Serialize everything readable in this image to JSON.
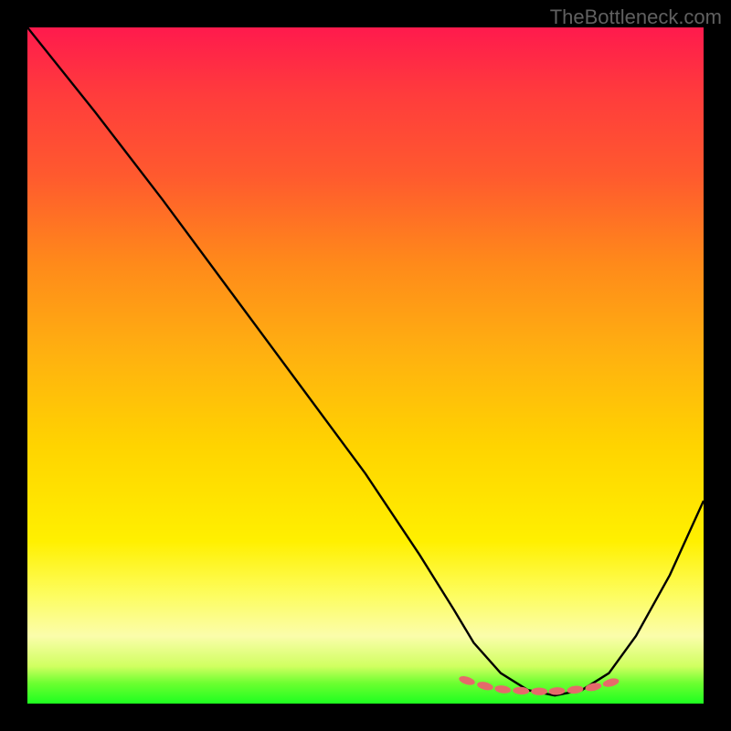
{
  "watermark": "TheBottleneck.com",
  "chart_data": {
    "type": "line",
    "title": "",
    "xlabel": "",
    "ylabel": "",
    "xlim": [
      0,
      100
    ],
    "ylim": [
      0,
      100
    ],
    "series": [
      {
        "name": "bottleneck-curve",
        "x": [
          0,
          10,
          20,
          30,
          40,
          50,
          58,
          63,
          66,
          70,
          74,
          78,
          82,
          86,
          90,
          95,
          100
        ],
        "values": [
          100,
          87.5,
          74.5,
          61,
          47.5,
          34,
          22,
          14,
          9,
          4.5,
          2,
          1.2,
          2,
          4.5,
          10,
          19,
          30
        ]
      }
    ],
    "markers": {
      "name": "dotted-basin",
      "color": "#e56a6a",
      "x": [
        65,
        67.7,
        70.3,
        73,
        75.7,
        78.3,
        81,
        83.7,
        86.3
      ],
      "values": [
        3.4,
        2.6,
        2.1,
        1.9,
        1.8,
        1.85,
        2.05,
        2.45,
        3.1
      ]
    },
    "gradient_stops": [
      {
        "pos": 0,
        "color": "#ff1a4d"
      },
      {
        "pos": 0.1,
        "color": "#ff3c3c"
      },
      {
        "pos": 0.22,
        "color": "#ff5a2e"
      },
      {
        "pos": 0.35,
        "color": "#ff8a1a"
      },
      {
        "pos": 0.48,
        "color": "#ffb010"
      },
      {
        "pos": 0.62,
        "color": "#ffd400"
      },
      {
        "pos": 0.76,
        "color": "#fff000"
      },
      {
        "pos": 0.84,
        "color": "#fdfd60"
      },
      {
        "pos": 0.9,
        "color": "#fbfdab"
      },
      {
        "pos": 0.945,
        "color": "#d0ff60"
      },
      {
        "pos": 0.97,
        "color": "#6cff30"
      },
      {
        "pos": 1.0,
        "color": "#1eff20"
      }
    ]
  }
}
